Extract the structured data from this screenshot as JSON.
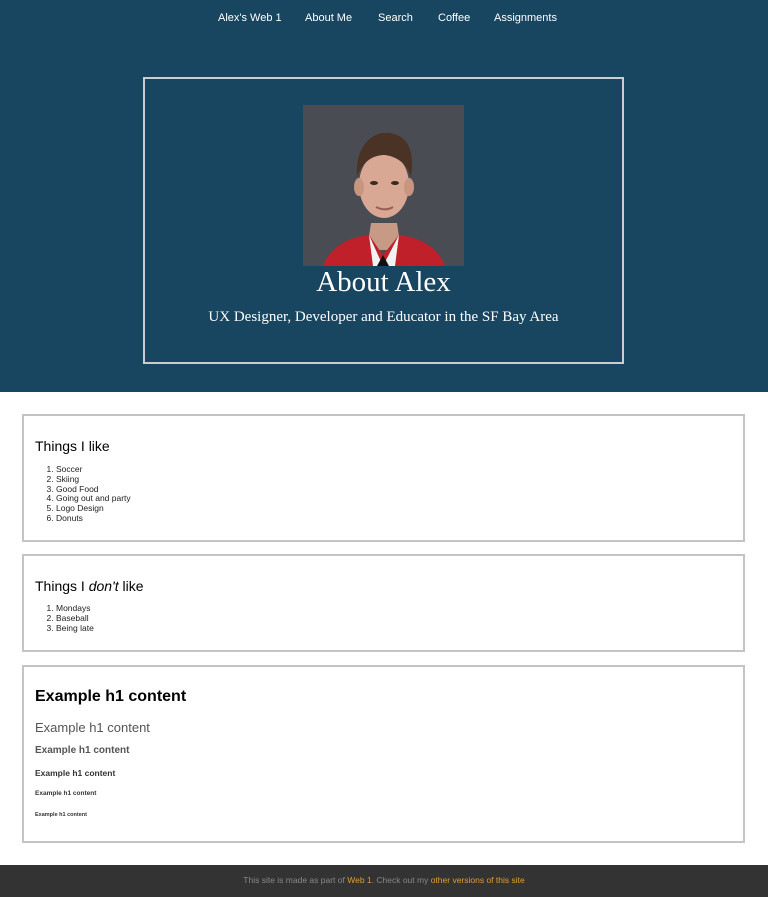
{
  "nav": {
    "items": [
      "Alex's Web 1",
      "About Me",
      "Search",
      "Coffee",
      "Assignments"
    ]
  },
  "hero": {
    "title": "About Alex",
    "subtitle": "UX Designer, Developer and Educator in the SF Bay Area"
  },
  "likes": {
    "heading": "Things I like",
    "items": [
      "Soccer",
      "Skiing",
      "Good Food",
      "Going out and party",
      "Logo Design",
      "Donuts"
    ]
  },
  "dislikes": {
    "heading_pre": "Things I ",
    "heading_em": "don't",
    "heading_post": " like",
    "items": [
      "Mondays",
      "Baseball",
      "Being late"
    ]
  },
  "examples": {
    "text": "Example h1 content"
  },
  "footer": {
    "text_1": "This site is made as part of ",
    "link_1": "Web 1",
    "text_2": ". Check out my ",
    "link_2": "other versions of this site"
  },
  "colors": {
    "header_bg": "#184660",
    "footer_bg": "#333333",
    "link_accent": "#e0a030"
  }
}
